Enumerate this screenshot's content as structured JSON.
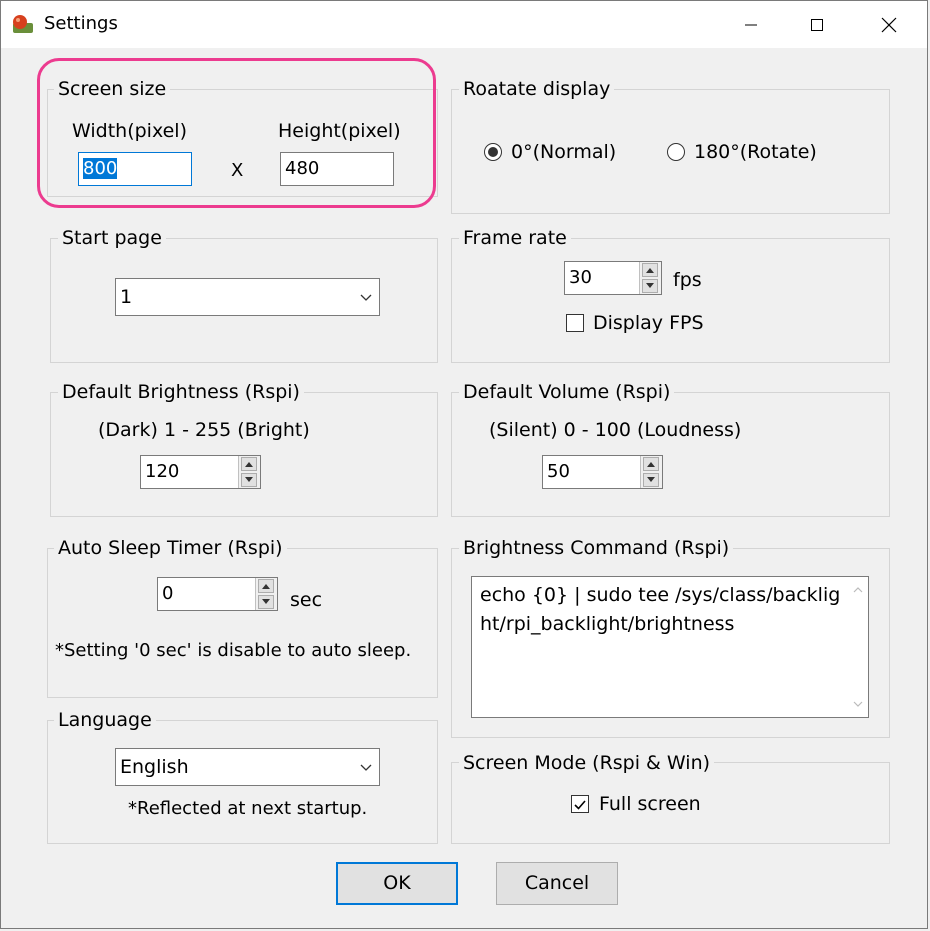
{
  "window": {
    "title": "Settings"
  },
  "screen_size": {
    "legend": "Screen size",
    "width_label": "Width(pixel)",
    "width_value": "800",
    "x_label": "X",
    "height_label": "Height(pixel)",
    "height_value": "480"
  },
  "rotate_display": {
    "legend": "Roatate display",
    "normal_label": "0°(Normal)",
    "rotate_label": "180°(Rotate)",
    "selected": "normal"
  },
  "start_page": {
    "legend": "Start page",
    "value": "1"
  },
  "frame_rate": {
    "legend": "Frame rate",
    "value": "30",
    "unit": "fps",
    "display_fps_label": "Display FPS",
    "display_fps_checked": false
  },
  "brightness": {
    "legend": "Default Brightness (Rspi)",
    "range_label": "(Dark) 1 - 255 (Bright)",
    "value": "120"
  },
  "volume": {
    "legend": "Default Volume (Rspi)",
    "range_label": "(Silent) 0 - 100 (Loudness)",
    "value": "50"
  },
  "auto_sleep": {
    "legend": "Auto Sleep Timer (Rspi)",
    "value": "0",
    "unit": "sec",
    "note": "*Setting '0 sec' is disable to auto sleep."
  },
  "brightness_command": {
    "legend": "Brightness Command (Rspi)",
    "value": "echo {0} | sudo tee /sys/class/backlight/rpi_backlight/brightness"
  },
  "language": {
    "legend": "Language",
    "value": "English",
    "note": "*Reflected at next startup."
  },
  "screen_mode": {
    "legend": "Screen Mode  (Rspi & Win)",
    "full_screen_label": "Full screen",
    "full_screen_checked": true
  },
  "buttons": {
    "ok": "OK",
    "cancel": "Cancel"
  },
  "colors": {
    "accent": "#0078d7",
    "highlight": "#ec3b8f",
    "background": "#f0f0f0"
  }
}
